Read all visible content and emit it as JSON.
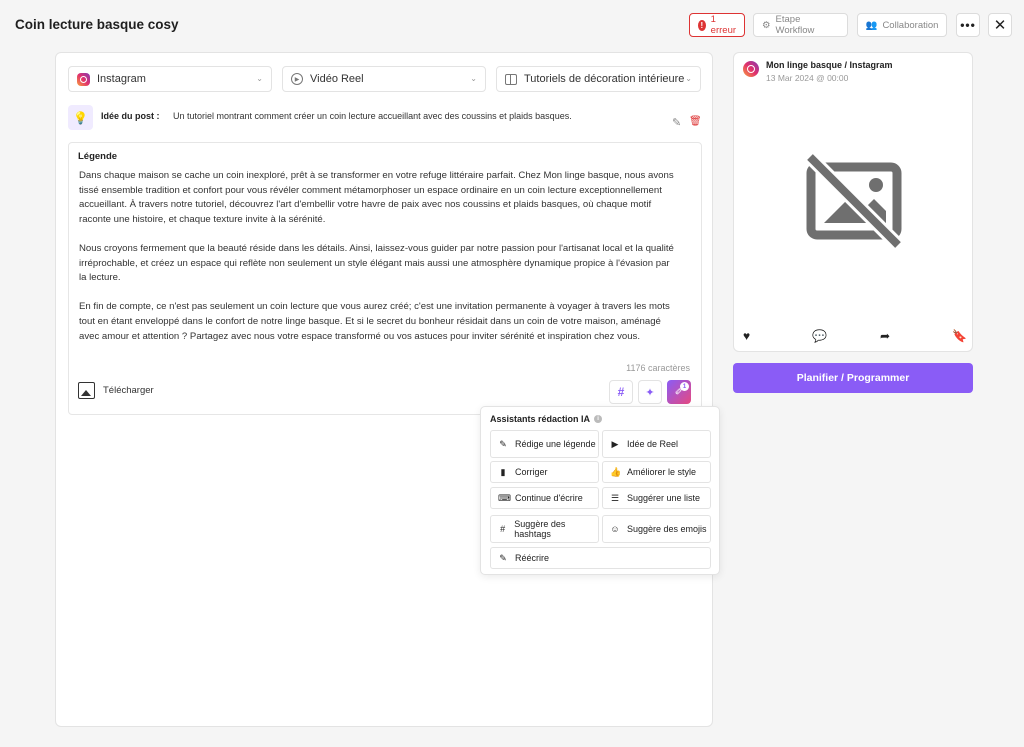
{
  "header": {
    "title": "Coin lecture basque cosy",
    "error_label": "1 erreur",
    "workflow_label": "Etape Workflow",
    "collaboration_label": "Collaboration",
    "more_label": "•••",
    "close_label": "✕"
  },
  "selectors": {
    "network": "Instagram",
    "format": "Vidéo Reel",
    "category": "Tutoriels de décoration intérieure"
  },
  "idea": {
    "label": "Idée du post :",
    "text": "Un tutoriel montrant comment créer un coin lecture accueillant avec des coussins et plaids basques."
  },
  "caption": {
    "label": "Légende",
    "paragraphs": [
      "Dans chaque maison se cache un coin inexploré, prêt à se transformer en votre refuge littéraire parfait. Chez Mon linge basque, nous avons tissé ensemble tradition et confort pour vous révéler comment métamorphoser un espace ordinaire en un coin lecture exceptionnellement accueillant. À travers notre tutoriel, découvrez l'art d'embellir votre havre de paix avec nos coussins et plaids basques, où chaque motif raconte une histoire, et chaque texture invite à la sérénité.",
      "Nous croyons fermement que la beauté réside dans les détails. Ainsi, laissez-vous guider par notre passion pour l'artisanat local et la qualité irréprochable, et créez un espace qui reflète non seulement un style élégant mais aussi une atmosphère dynamique propice à l'évasion par la lecture.",
      "En fin de compte, ce n'est pas seulement un coin lecture que vous aurez créé; c'est une invitation permanente à voyager à travers les mots tout en étant enveloppé dans le confort de notre linge basque. Et si le secret du bonheur résidait dans un coin de votre maison, aménagé avec amour et attention ? Partagez avec nous votre espace transformé ou vos astuces pour inviter sérénité et inspiration chez vous."
    ],
    "char_count": "1176 caractères",
    "upload_label": "Télécharger",
    "ai_badge": "1"
  },
  "ai_panel": {
    "title": "Assistants rédaction IA",
    "buttons": [
      "Rédige une légende",
      "Idée de Reel",
      "Corriger",
      "Améliorer le style",
      "Continue d'écrire",
      "Suggérer une liste",
      "Suggère des hashtags",
      "Suggère des emojis",
      "Réécrire"
    ]
  },
  "preview": {
    "account": "Mon linge basque / Instagram",
    "date": "13 Mar 2024 @ 00:00"
  },
  "plan_button": "Planifier / Programmer",
  "colors": {
    "accent": "#8a5cf6",
    "error": "#dd3333"
  }
}
